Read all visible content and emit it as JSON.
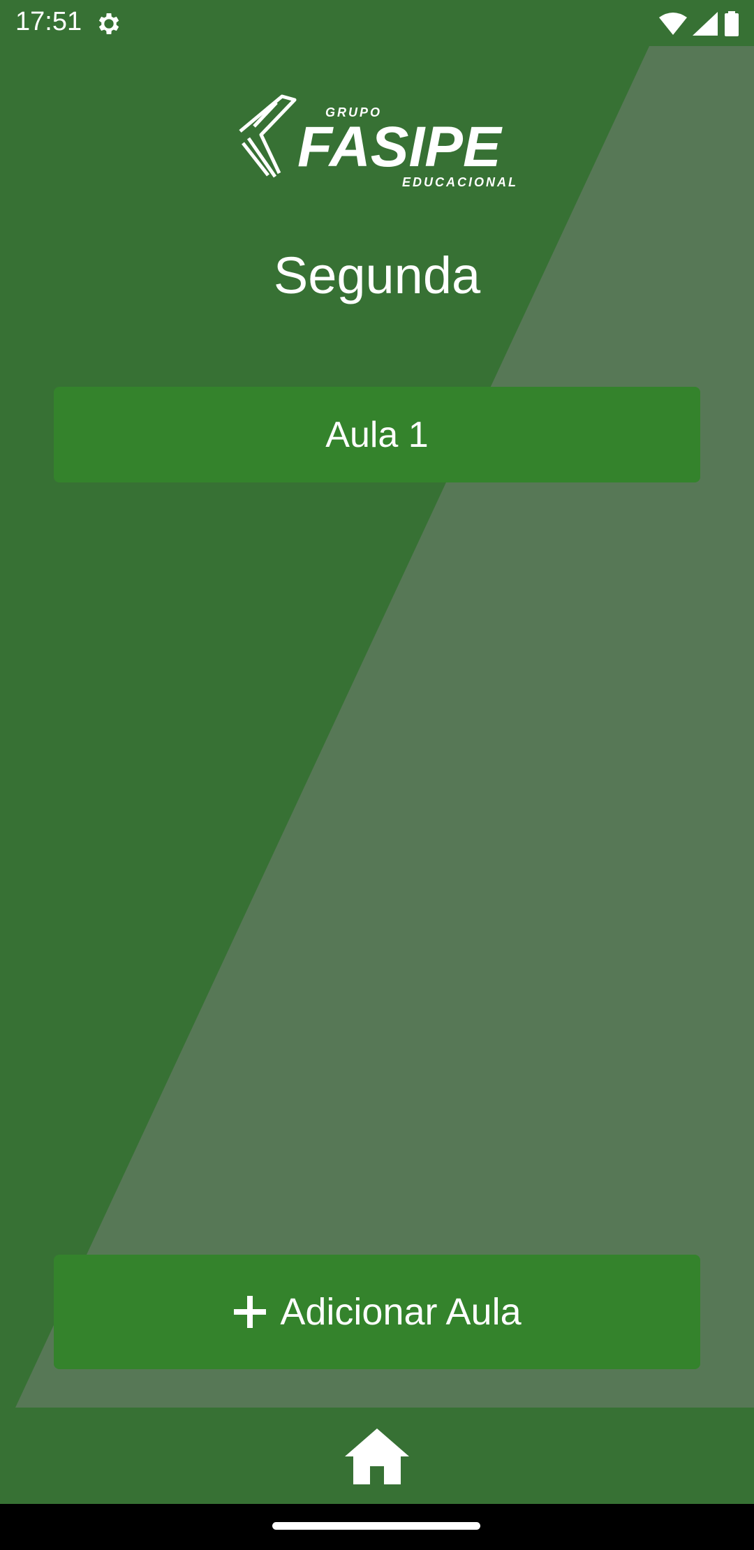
{
  "status_bar": {
    "time": "17:51",
    "icons": [
      "gear-icon",
      "wifi-icon",
      "signal-icon",
      "battery-icon"
    ]
  },
  "logo": {
    "group": "GRUPO",
    "brand": "FASIPE",
    "sub": "EDUCACIONAL"
  },
  "page": {
    "title": "Segunda"
  },
  "lessons": [
    {
      "label": "Aula 1"
    }
  ],
  "actions": {
    "add_lesson_label": "Adicionar Aula",
    "add_icon": "plus-icon"
  },
  "bottom_nav": {
    "home_icon": "home-icon"
  },
  "colors": {
    "background": "#377134",
    "diagonal_panel": "#577856",
    "button": "#34832c",
    "text": "#ffffff"
  }
}
